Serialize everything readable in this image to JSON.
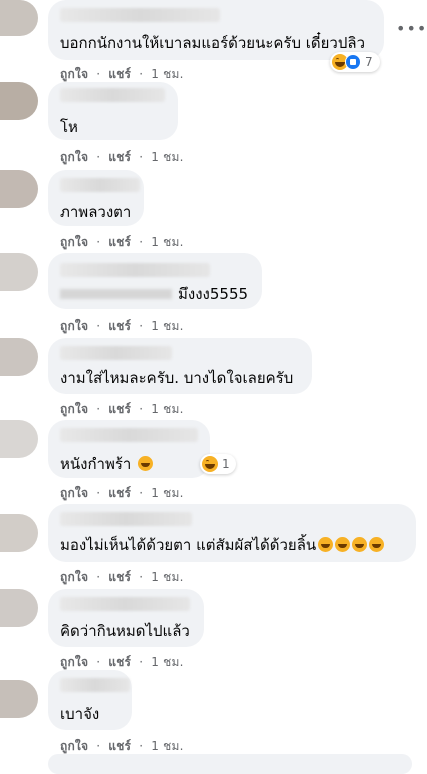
{
  "actions": {
    "like": "ถูกใจ",
    "reply": "แชร์",
    "time": "1 ชม.",
    "sep": "·"
  },
  "comments": [
    {
      "text": "บอกกนักงานให้เบาลมแอร์ด้วยนะครับ  เดี๋ยวปลิว",
      "reactions": {
        "icons": [
          "haha-icon",
          "like-icon"
        ],
        "count": "7"
      }
    },
    {
      "text": "โห"
    },
    {
      "text": "ภาพลวงตา"
    },
    {
      "text": "มึงงง5555"
    },
    {
      "text": "งามใส่ไหมละครับ. บางไดใจเลยครับ"
    },
    {
      "text": "หนังกำพร้า",
      "emoji": "grinning-face-icon",
      "reactions": {
        "icons": [
          "haha-icon"
        ],
        "count": "1"
      }
    },
    {
      "text": "มองไม่เห็นได้ด้วยตา แต่สัมผัสได้ด้วยลิ้น",
      "emoji": "rolling-laughing-icon x4"
    },
    {
      "text": "คิดว่ากินหมดไปแล้ว"
    },
    {
      "text": "เบาจัง"
    }
  ],
  "colors": {
    "bubble": "#f0f2f5",
    "meta": "#65676b",
    "text": "#050505",
    "like_blue": "#1877f2",
    "haha_yellow": "#f7b125"
  }
}
